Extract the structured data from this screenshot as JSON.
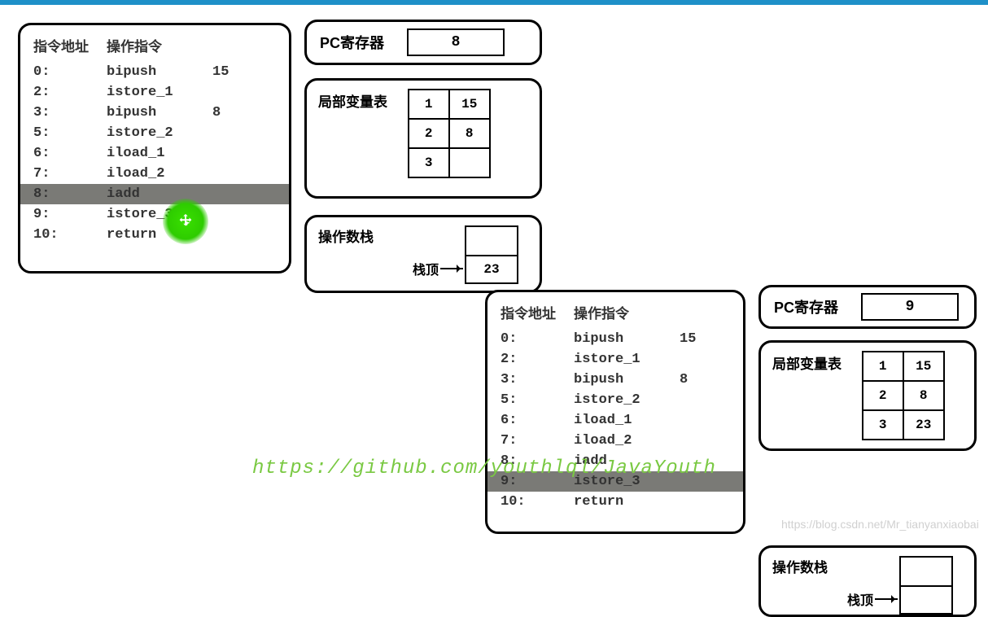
{
  "headers": {
    "addr": "指令地址",
    "op": "操作指令"
  },
  "labels": {
    "pc_register": "PC寄存器",
    "local_vars": "局部变量表",
    "operand_stack": "操作数栈",
    "stack_top": "栈顶"
  },
  "instructions": [
    {
      "addr": "0:",
      "op": "bipush",
      "arg": "15"
    },
    {
      "addr": "2:",
      "op": "istore_1",
      "arg": ""
    },
    {
      "addr": "3:",
      "op": "bipush",
      "arg": "8"
    },
    {
      "addr": "5:",
      "op": "istore_2",
      "arg": ""
    },
    {
      "addr": "6:",
      "op": "iload_1",
      "arg": ""
    },
    {
      "addr": "7:",
      "op": "iload_2",
      "arg": ""
    },
    {
      "addr": "8:",
      "op": "iadd",
      "arg": ""
    },
    {
      "addr": "9:",
      "op": "istore_3",
      "arg": ""
    },
    {
      "addr": "10:",
      "op": "return",
      "arg": ""
    }
  ],
  "frame1": {
    "pc": "8",
    "highlight_addr": "8:",
    "local_vars": [
      {
        "idx": "1",
        "val": "15"
      },
      {
        "idx": "2",
        "val": "8"
      },
      {
        "idx": "3",
        "val": ""
      }
    ],
    "operand_stack": [
      {
        "val": ""
      },
      {
        "val": "23"
      }
    ],
    "stack_top_row": 1
  },
  "frame2": {
    "pc": "9",
    "highlight_addr": "9:",
    "local_vars": [
      {
        "idx": "1",
        "val": "15"
      },
      {
        "idx": "2",
        "val": "8"
      },
      {
        "idx": "3",
        "val": "23"
      }
    ],
    "operand_stack": [
      {
        "val": ""
      },
      {
        "val": ""
      }
    ],
    "stack_top_row": 1
  },
  "watermarks": {
    "github": "https://github.com/youthlql/JavaYouth",
    "csdn": "https://blog.csdn.net/Mr_tianyanxiaobai"
  }
}
